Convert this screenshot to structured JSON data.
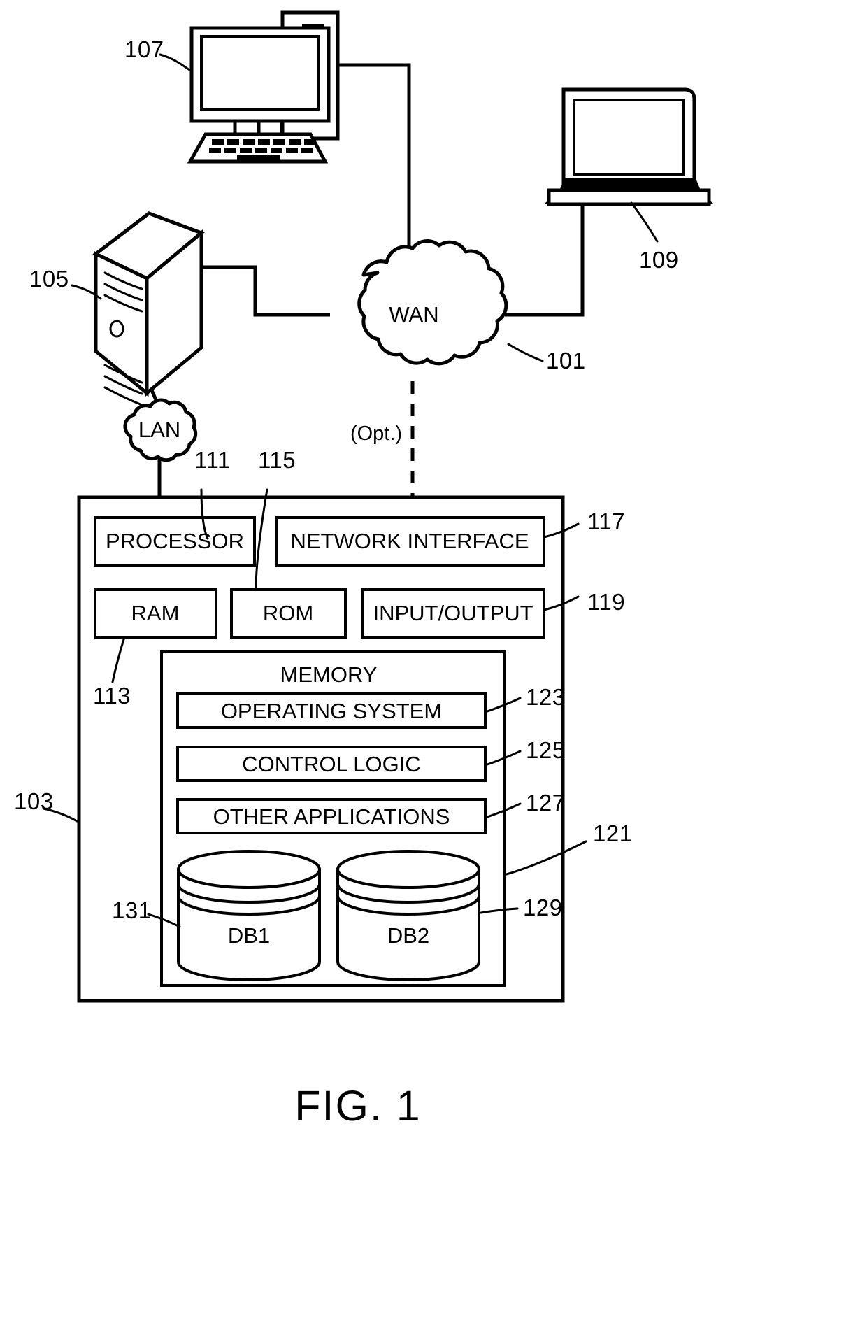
{
  "figure": {
    "caption": "FIG. 1",
    "type": "patent-block-diagram"
  },
  "networks": {
    "wan": {
      "label": "WAN",
      "ref": "101"
    },
    "lan": {
      "label": "LAN",
      "ref": ""
    },
    "optional_link": {
      "label": "(Opt.)"
    }
  },
  "devices": {
    "desktop_computer": {
      "ref": "107",
      "icon": "desktop-computer-icon"
    },
    "laptop_computer": {
      "ref": "109",
      "icon": "laptop-icon"
    },
    "server_tower": {
      "ref": "105",
      "icon": "server-tower-icon"
    }
  },
  "computing_device": {
    "ref": "103",
    "components": [
      {
        "label": "PROCESSOR",
        "ref": "111"
      },
      {
        "label": "NETWORK INTERFACE",
        "ref": "117"
      },
      {
        "label": "RAM",
        "ref": "113"
      },
      {
        "label": "ROM",
        "ref": "115"
      },
      {
        "label": "INPUT/OUTPUT",
        "ref": "119"
      }
    ],
    "memory": {
      "label": "MEMORY",
      "ref": "121",
      "modules": [
        {
          "label": "OPERATING SYSTEM",
          "ref": "123"
        },
        {
          "label": "CONTROL LOGIC",
          "ref": "125"
        },
        {
          "label": "OTHER APPLICATIONS",
          "ref": "127"
        }
      ],
      "databases": [
        {
          "label": "DB1",
          "ref": "131"
        },
        {
          "label": "DB2",
          "ref": "129"
        }
      ]
    }
  },
  "colors": {
    "stroke": "#000000",
    "fill": "#ffffff"
  }
}
